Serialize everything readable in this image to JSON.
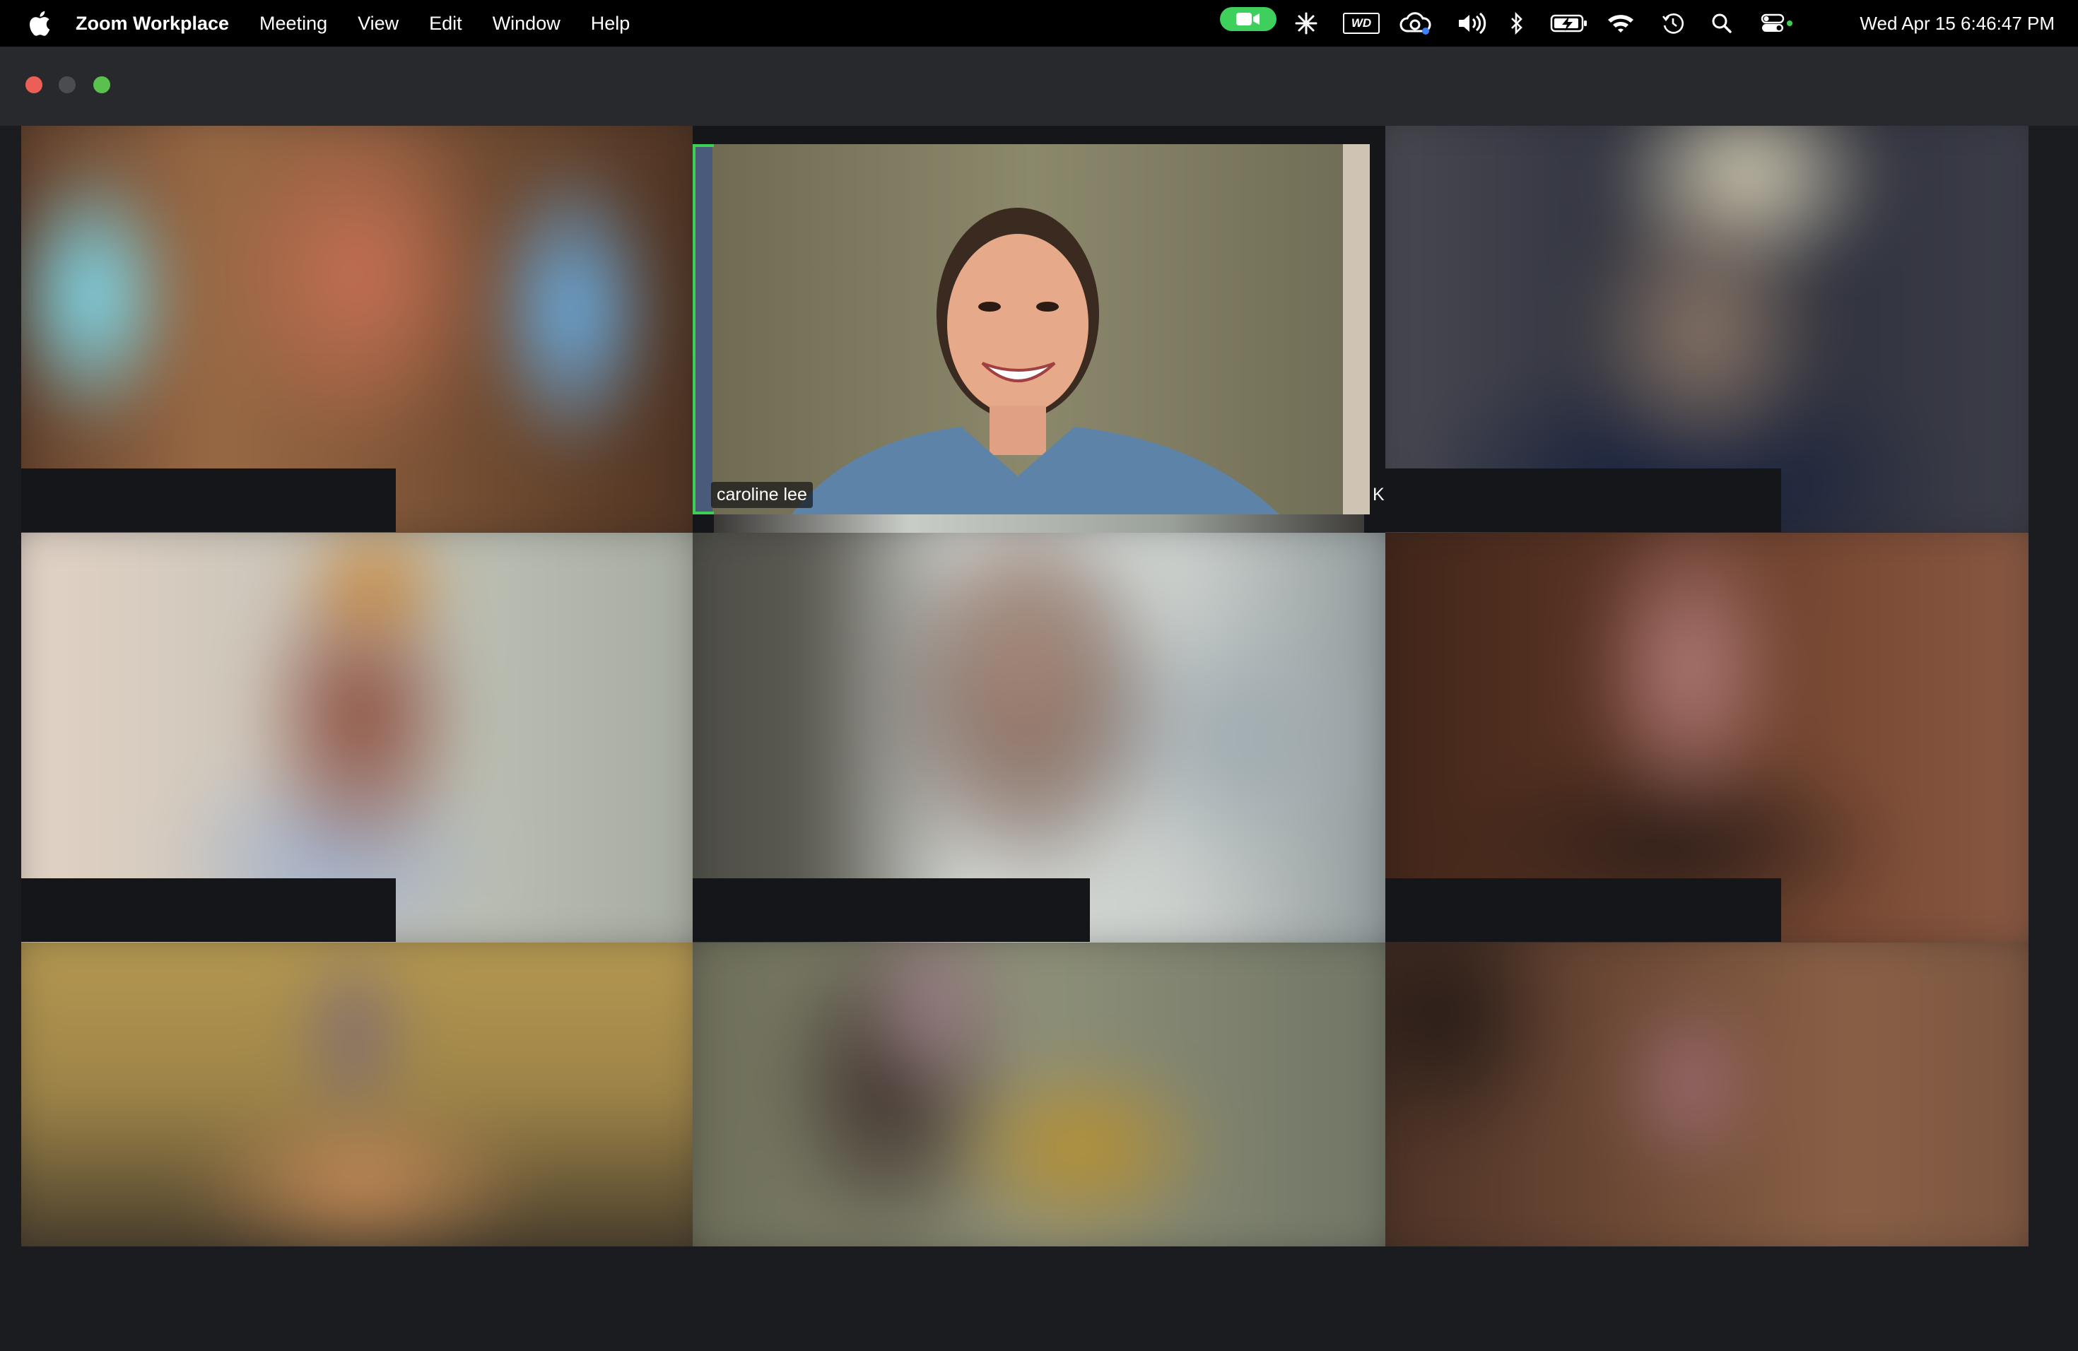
{
  "menubar": {
    "apple_icon": "apple-logo-icon",
    "app_name": "Zoom Workplace",
    "menus": [
      "Meeting",
      "View",
      "Edit",
      "Window",
      "Help"
    ],
    "status_icons": [
      "zoom-camera-icon",
      "sparkle-icon",
      "wd-icon",
      "cloud-sync-icon",
      "volume-icon",
      "bluetooth-icon",
      "battery-charging-icon",
      "wifi-icon",
      "time-machine-icon",
      "spotlight-search-icon",
      "control-center-icon"
    ],
    "status_wd_text": "WD",
    "clock": "Wed Apr 15  6:46:47 PM"
  },
  "meeting": {
    "active_speaker": "caroline lee",
    "partial_name": "K",
    "active_speaker_color": "#3cd155",
    "participant_tile_count": 9
  }
}
